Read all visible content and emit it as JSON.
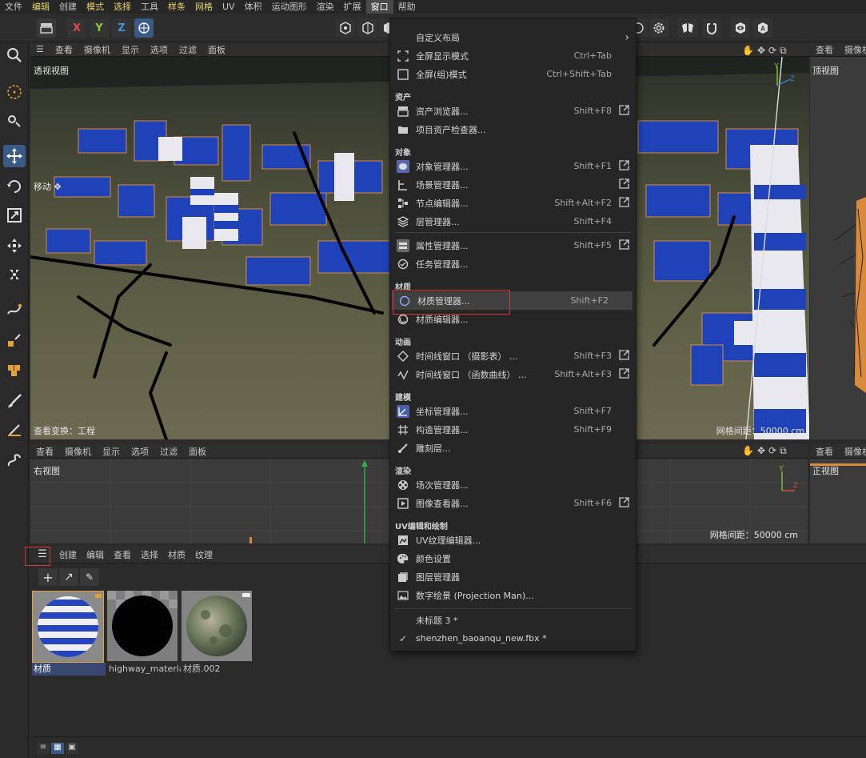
{
  "menubar": {
    "items": [
      "文件",
      "编辑",
      "创建",
      "模式",
      "选择",
      "工具",
      "样条",
      "网格",
      "UV",
      "体积",
      "运动图形",
      "渲染",
      "扩展",
      "窗口",
      "帮助"
    ]
  },
  "toolbar": {
    "axes": [
      "X",
      "Y",
      "Z"
    ]
  },
  "viewport_top": {
    "menu": [
      "查看",
      "摄像机",
      "显示",
      "选项",
      "过滤",
      "面板"
    ],
    "name": "透视视图",
    "tool_label": "移动",
    "bottom_left": "查看变换：工程",
    "grid_info": "网格间距：50000 cm"
  },
  "viewport_bottom": {
    "menu": [
      "查看",
      "摄像机",
      "显示",
      "选项",
      "过滤",
      "面板"
    ],
    "name": "右视图",
    "grid_info": "网格间距：50000 cm"
  },
  "side_top": {
    "menu": [
      "查看",
      "摄像机"
    ],
    "name": "顶视图"
  },
  "side_bottom": {
    "menu": [
      "查看",
      "摄像机"
    ],
    "name": "正视图"
  },
  "material_panel": {
    "menu": [
      "创建",
      "编辑",
      "查看",
      "选择",
      "材质",
      "纹理"
    ],
    "materials": [
      {
        "name": "材质",
        "icon": "striped-sphere-icon"
      },
      {
        "name": "highway_material",
        "icon": "black-sphere-icon"
      },
      {
        "name": "材质.002",
        "icon": "terrain-sphere-icon"
      }
    ]
  },
  "dropdown": {
    "top_items": [
      {
        "label": "自定义布局",
        "shortcut": "",
        "submenu": true
      },
      {
        "label": "全屏显示模式",
        "shortcut": "Ctrl+Tab"
      },
      {
        "label": "全屏(组)模式",
        "shortcut": "Ctrl+Shift+Tab"
      }
    ],
    "sections": [
      {
        "title": "资产",
        "items": [
          {
            "label": "资产浏览器...",
            "shortcut": "Shift+F8",
            "popout": true
          },
          {
            "label": "项目资产检查器...",
            "shortcut": "",
            "popout": false
          }
        ]
      },
      {
        "title": "对象",
        "items": [
          {
            "label": "对象管理器...",
            "shortcut": "Shift+F1",
            "popout": true
          },
          {
            "label": "场景管理器...",
            "shortcut": "",
            "popout": true
          },
          {
            "label": "节点编辑器...",
            "shortcut": "Shift+Alt+F2",
            "popout": true
          },
          {
            "label": "层管理器...",
            "shortcut": "Shift+F4",
            "popout": false
          },
          {
            "label": "属性管理器...",
            "shortcut": "Shift+F5",
            "popout": true
          },
          {
            "label": "任务管理器...",
            "shortcut": "",
            "popout": false
          }
        ]
      },
      {
        "title": "材质",
        "items": [
          {
            "label": "材质管理器...",
            "shortcut": "Shift+F2",
            "popout": false,
            "highlight": true
          },
          {
            "label": "材质编辑器...",
            "shortcut": "",
            "popout": false
          }
        ]
      },
      {
        "title": "动画",
        "items": [
          {
            "label": "时间线窗口 （摄影表） ...",
            "shortcut": "Shift+F3",
            "popout": true
          },
          {
            "label": "时间线窗口 （函数曲线） ...",
            "shortcut": "Shift+Alt+F3",
            "popout": true
          }
        ]
      },
      {
        "title": "建模",
        "items": [
          {
            "label": "坐标管理器...",
            "shortcut": "Shift+F7",
            "popout": false
          },
          {
            "label": "构造管理器...",
            "shortcut": "Shift+F9",
            "popout": false
          },
          {
            "label": "雕刻层...",
            "shortcut": "",
            "popout": false
          }
        ]
      },
      {
        "title": "渲染",
        "items": [
          {
            "label": "场次管理器...",
            "shortcut": "",
            "popout": false
          },
          {
            "label": "图像查看器...",
            "shortcut": "Shift+F6",
            "popout": true
          }
        ]
      },
      {
        "title": "UV编辑和绘制",
        "items": [
          {
            "label": "UV纹理编辑器...",
            "shortcut": "",
            "popout": false
          },
          {
            "label": "颜色设置",
            "shortcut": "",
            "popout": false
          },
          {
            "label": "图层管理器",
            "shortcut": "",
            "popout": false
          },
          {
            "label": "数字绘景 (Projection Man)...",
            "shortcut": "",
            "popout": false
          }
        ]
      }
    ],
    "documents": [
      {
        "label": "未标题 3 *",
        "checked": false
      },
      {
        "label": "shenzhen_baoanqu_new.fbx *",
        "checked": true
      }
    ]
  },
  "colors": {
    "accent_blue": "#3a5a86",
    "highlight_red": "#d9363e",
    "menu_active_yellow": "#e8d36a"
  }
}
